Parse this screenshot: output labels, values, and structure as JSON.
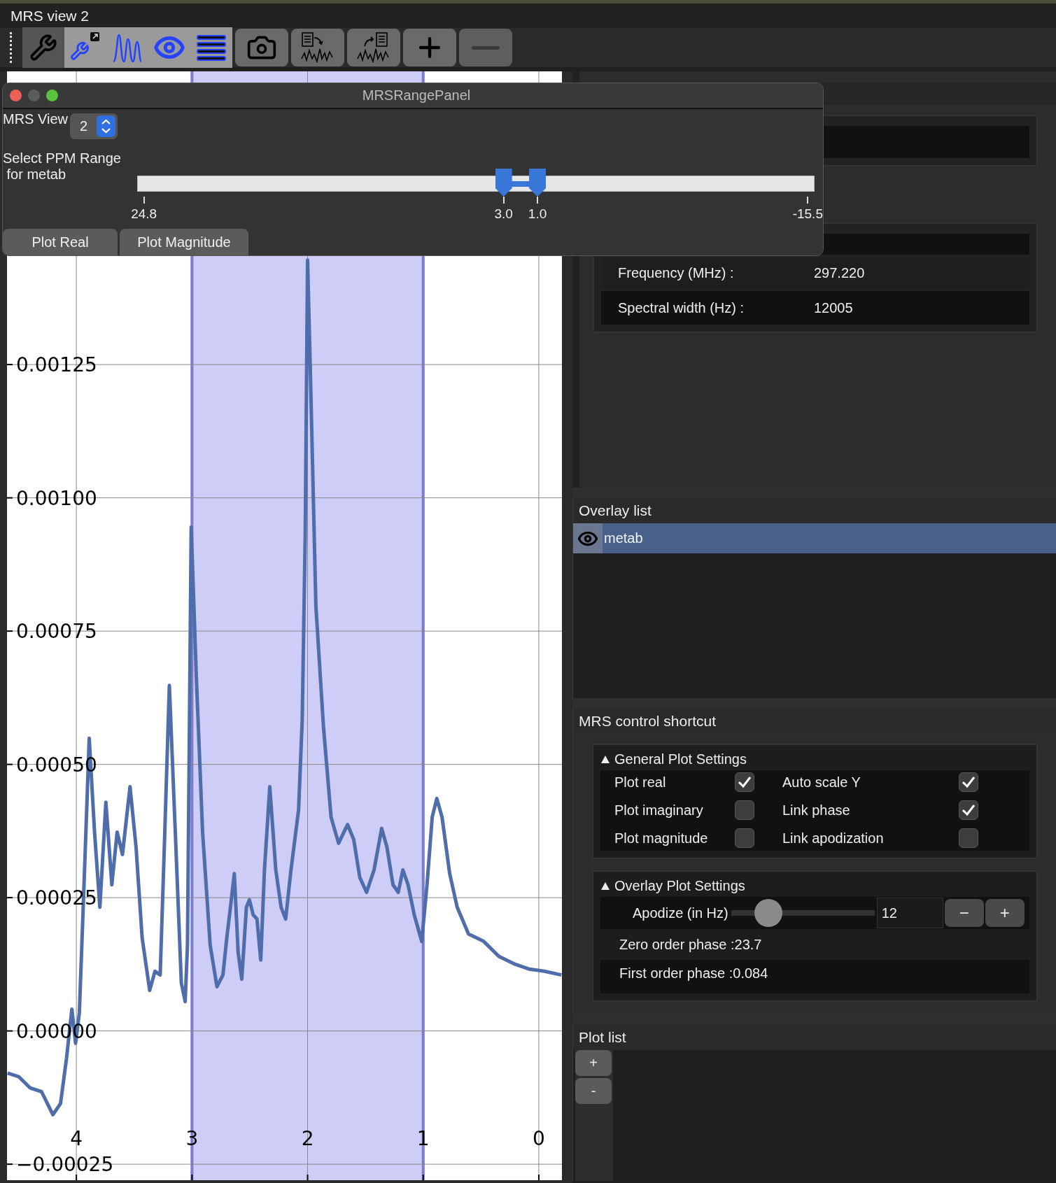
{
  "window": {
    "title": "MRS view 2"
  },
  "toolbar": [
    {
      "selected": true,
      "disabled": false
    },
    {
      "selected": false,
      "disabled": false
    },
    {
      "selected": false,
      "disabled": false
    },
    {
      "selected": false,
      "disabled": false
    },
    {
      "selected": false,
      "disabled": false
    },
    {
      "selected": false,
      "disabled": false
    },
    {
      "selected": false,
      "disabled": false
    },
    {
      "selected": false,
      "disabled": false
    },
    {
      "selected": false,
      "disabled": false
    },
    {
      "selected": false,
      "disabled": true
    }
  ],
  "range_panel": {
    "title": "MRSRangePanel",
    "view_label": "MRS View",
    "view_value": "2",
    "range_label": "Select PPM Range\n for metab",
    "min_label": "24.8",
    "max_label": "-15.5",
    "thumbs": [
      {
        "label": "3.0",
        "level": 0.541
      },
      {
        "label": "1.0",
        "level": 0.591
      }
    ],
    "buttons": [
      "Plot Real",
      "Plot Magnitude"
    ]
  },
  "plot": {
    "chart_data": {
      "type": "line",
      "xlim": [
        4.6,
        -0.2
      ],
      "ylim": [
        -0.00028,
        0.0018
      ],
      "xticks": [
        4,
        3,
        2,
        1,
        0
      ],
      "yticks": [
        {
          "value": -0.00025,
          "label": "−0.00025"
        },
        {
          "value": 0,
          "label": "0.00000"
        },
        {
          "value": 0.00025,
          "label": "0.00025"
        },
        {
          "value": 0.0005,
          "label": "0.00050"
        },
        {
          "value": 0.00075,
          "label": "0.00075"
        },
        {
          "value": 0.001,
          "label": "0.00100"
        },
        {
          "value": 0.00125,
          "label": "0.00125"
        }
      ],
      "x": [
        4.595,
        4.497,
        4.399,
        4.301,
        4.203,
        4.137,
        4.085,
        4.039,
        4.007,
        3.974,
        3.941,
        3.889,
        3.843,
        3.797,
        3.745,
        3.693,
        3.647,
        3.601,
        3.536,
        3.484,
        3.431,
        3.366,
        3.32,
        3.275,
        3.235,
        3.196,
        3.144,
        3.092,
        3.059,
        3.039,
        3.007,
        2.961,
        2.908,
        2.843,
        2.784,
        2.732,
        2.699,
        2.667,
        2.634,
        2.601,
        2.569,
        2.529,
        2.503,
        2.471,
        2.438,
        2.405,
        2.373,
        2.327,
        2.275,
        2.229,
        2.19,
        2.144,
        2.078,
        2.046,
        2.02,
        2.0,
        1.974,
        1.928,
        1.863,
        1.797,
        1.732,
        1.654,
        1.601,
        1.549,
        1.49,
        1.425,
        1.359,
        1.314,
        1.261,
        1.216,
        1.176,
        1.131,
        1.078,
        1.013,
        0.967,
        0.922,
        0.882,
        0.837,
        0.771,
        0.706,
        0.608,
        0.477,
        0.346,
        0.216,
        0.085,
        -0.046,
        -0.196
      ],
      "series": [
        {
          "color": "#4f6dab",
          "values": [
            -7.9e-05,
            -8.6e-05,
            -0.000107,
            -0.000114,
            -0.000157,
            -0.000136,
            -5.1e-05,
            4.1e-05,
            -2.3e-05,
            3.4e-05,
            0.000232,
            0.000549,
            0.000373,
            0.000232,
            0.000429,
            0.000274,
            0.000373,
            0.000331,
            0.000458,
            0.000345,
            0.000175,
            7.6e-05,
            0.000112,
            0.000105,
            0.000373,
            0.000648,
            0.000373,
            9e-05,
            5.5e-05,
            0.000161,
            0.000945,
            0.000655,
            0.000373,
            0.000161,
            8.3e-05,
            0.000105,
            0.000175,
            0.000232,
            0.000295,
            0.000147,
            9.7e-05,
            0.000232,
            0.000246,
            0.000218,
            0.00021,
            0.000133,
            0.000302,
            0.000458,
            0.000302,
            0.000232,
            0.00021,
            0.000302,
            0.000415,
            0.000585,
            0.000938,
            0.001446,
            0.00122,
            0.000797,
            0.000571,
            0.000401,
            0.000352,
            0.000387,
            0.000359,
            0.000288,
            0.00026,
            0.000302,
            0.00038,
            0.000345,
            0.000274,
            0.00026,
            0.000302,
            0.000274,
            0.000218,
            0.000168,
            0.000274,
            0.000401,
            0.000436,
            0.000401,
            0.000295,
            0.000232,
            0.000182,
            0.000168,
            0.00014,
            0.000126,
            0.000116,
            0.000112,
            0.000105
          ]
        }
      ],
      "grid": true
    }
  },
  "info_rows": [
    {
      "label": "Frequency (MHz) :",
      "value": "297.220"
    },
    {
      "label": "Spectral width (Hz) :",
      "value": "12005"
    }
  ],
  "overlay_list": {
    "title": "Overlay list",
    "items": [
      {
        "label": "metab",
        "selected": true,
        "visible": true
      }
    ]
  },
  "control_shortcut": {
    "title": "MRS control shortcut",
    "general": {
      "title": "General Plot Settings",
      "expanded": true,
      "options": [
        {
          "label": "Plot real",
          "checked": true
        },
        {
          "label": "Auto scale Y",
          "checked": true
        },
        {
          "label": "Plot imaginary",
          "checked": false
        },
        {
          "label": "Link phase",
          "checked": true
        },
        {
          "label": "Plot magnitude",
          "checked": false
        },
        {
          "label": "Link apodization",
          "checked": false
        }
      ]
    },
    "overlay": {
      "title": "Overlay Plot Settings",
      "expanded": true,
      "apodize": {
        "label": "Apodize (in Hz)",
        "level": 0.18,
        "value": "12",
        "minus": "−",
        "plus": "+"
      },
      "zero_phase": "Zero order phase :23.7",
      "first_phase": "First order phase :0.084"
    }
  },
  "plot_list": {
    "title": "Plot list",
    "buttons": [
      "+",
      "-"
    ]
  }
}
